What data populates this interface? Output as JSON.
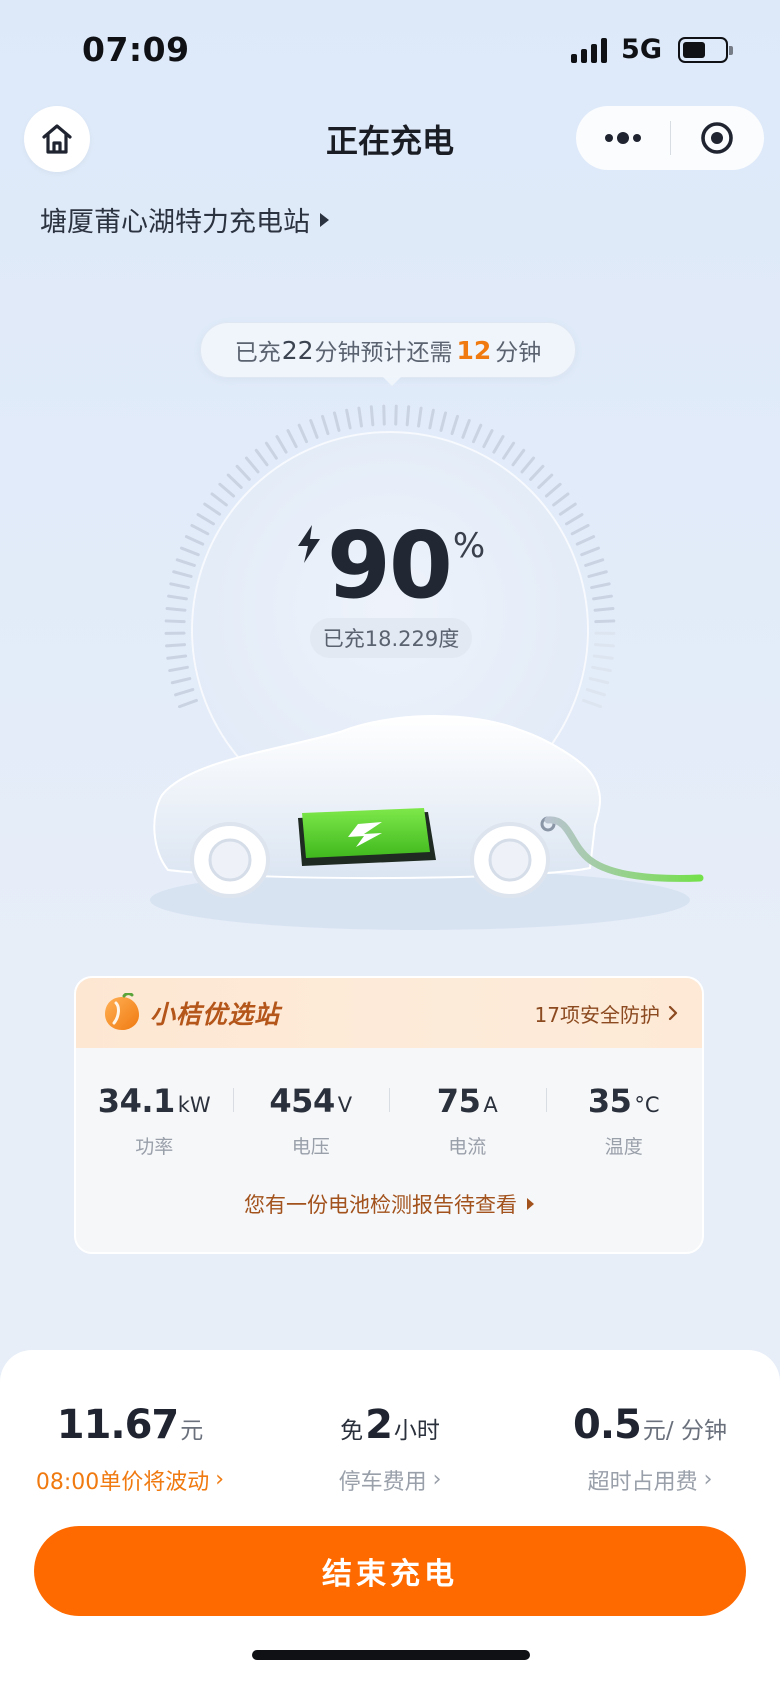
{
  "status_bar": {
    "time": "07:09",
    "network": "5G",
    "battery_level": 0.55
  },
  "header": {
    "title": "正在充电",
    "home_icon": "home-icon",
    "more_icon": "more-dots-icon",
    "target_icon": "target-icon"
  },
  "station": {
    "name": "塘厦莆心湖特力充电站"
  },
  "progress": {
    "charged_prefix": "已充",
    "charged_minutes": "22",
    "mid_text": "分钟预计还需",
    "remaining_minutes": "12",
    "suffix": "分钟",
    "percent": "90",
    "percent_sign": "%",
    "energy_text": "已充18.229度",
    "percent_value": 0.9
  },
  "info_card": {
    "brand": "小桔优选站",
    "safety_text": "17项安全防护",
    "stats": [
      {
        "value": "34.1",
        "unit": "kW",
        "label": "功率"
      },
      {
        "value": "454",
        "unit": "V",
        "label": "电压"
      },
      {
        "value": "75",
        "unit": "A",
        "label": "电流"
      },
      {
        "value": "35",
        "unit": "°C",
        "label": "温度"
      }
    ],
    "report_text": "您有一份电池检测报告待查看"
  },
  "fees": {
    "price": {
      "value": "11.67",
      "unit": "元",
      "note": "08:00单价将波动"
    },
    "parking": {
      "prefix": "免",
      "value": "2",
      "unit": "小时",
      "label": "停车费用"
    },
    "overtime": {
      "value": "0.5",
      "unit": "元/ 分钟",
      "label": "超时占用费"
    }
  },
  "actions": {
    "end_label": "结束充电"
  },
  "colors": {
    "accent": "#ff6a00",
    "highlight": "#f07a10",
    "battery_green": "#5ad82e"
  }
}
